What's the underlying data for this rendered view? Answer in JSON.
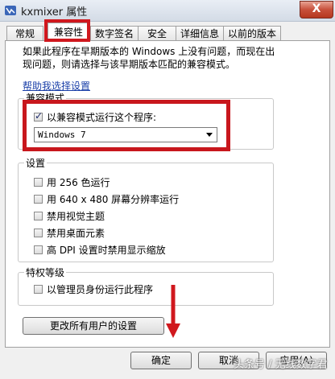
{
  "window": {
    "title": "kxmixer 属性",
    "close_label": "X"
  },
  "tabs": [
    {
      "label": "常规"
    },
    {
      "label": "兼容性"
    },
    {
      "label": "数字签名"
    },
    {
      "label": "安全"
    },
    {
      "label": "详细信息"
    },
    {
      "label": "以前的版本"
    }
  ],
  "intro": {
    "line1": "如果此程序在早期版本的 Windows 上没有问题，而现在出",
    "line2": "现问题，则请选择与该早期版本匹配的兼容模式。"
  },
  "help_link": "帮助我选择设置",
  "compat_mode": {
    "group_label": "兼容模式",
    "checkbox_label": "以兼容模式运行这个程序:",
    "checked": true,
    "selected_os": "Windows 7"
  },
  "settings": {
    "group_label": "设置",
    "items": [
      {
        "label": "用 256 色运行",
        "checked": false
      },
      {
        "label": "用 640 x 480 屏幕分辨率运行",
        "checked": false
      },
      {
        "label": "禁用视觉主题",
        "checked": false
      },
      {
        "label": "禁用桌面元素",
        "checked": false
      },
      {
        "label": "高 DPI 设置时禁用显示缩放",
        "checked": false
      }
    ]
  },
  "privilege": {
    "group_label": "特权等级",
    "checkbox_label": "以管理员身份运行此程序",
    "checked": false
  },
  "all_users_button": "更改所有用户的设置",
  "footer": {
    "ok": "确定",
    "cancel": "取消",
    "apply": "应用(A)"
  },
  "watermark": "头条号 / 无线数字君",
  "colors": {
    "highlight": "#d0181e",
    "link": "#1a3fa8"
  }
}
